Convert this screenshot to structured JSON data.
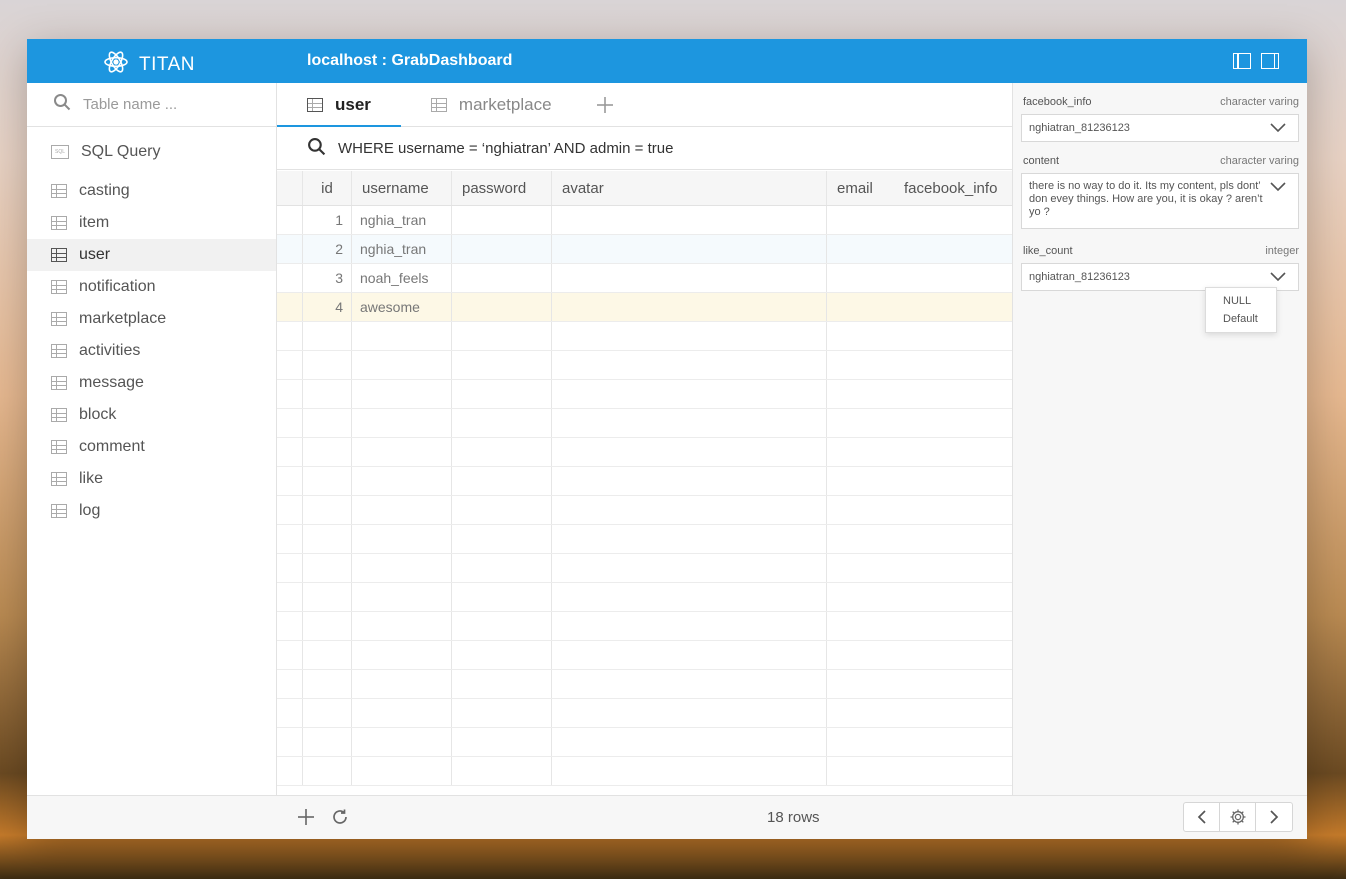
{
  "app": {
    "name": "TITAN",
    "connection_title": "localhost : GrabDashboard"
  },
  "sidebar": {
    "search_placeholder": "Table name ...",
    "sql_query_label": "SQL Query",
    "tables": [
      "casting",
      "item",
      "user",
      "notification",
      "marketplace",
      "activities",
      "message",
      "block",
      "comment",
      "like",
      "log"
    ],
    "active_table": "user"
  },
  "tabs": [
    {
      "label": "user",
      "active": true
    },
    {
      "label": "marketplace",
      "active": false
    }
  ],
  "filter": {
    "query": "WHERE username = ‘nghiatran’ AND admin = true"
  },
  "grid": {
    "columns": [
      "id",
      "username",
      "password",
      "avatar",
      "email",
      "facebook_info"
    ],
    "rows": [
      {
        "id": "1",
        "username": "nghia_tran"
      },
      {
        "id": "2",
        "username": "nghia_tran"
      },
      {
        "id": "3",
        "username": "noah_feels"
      },
      {
        "id": "4",
        "username": "awesome"
      }
    ]
  },
  "footer": {
    "row_count": "18 rows"
  },
  "detail_panel": {
    "fields": [
      {
        "name": "facebook_info",
        "type": "character varing",
        "value": "nghiatran_81236123"
      },
      {
        "name": "content",
        "type": "character varing",
        "value": "there is no way to do it. Its my content, pls dont’ don evey things. How are you, it is okay ? aren’t yo ?"
      },
      {
        "name": "like_count",
        "type": "integer",
        "value": "nghiatran_81236123"
      }
    ],
    "dropdown_options": [
      "NULL",
      "Default"
    ]
  },
  "colors": {
    "accent": "#1d96df",
    "highlight_row": "#fdf8e6",
    "selected_row": "#f5fafd"
  }
}
